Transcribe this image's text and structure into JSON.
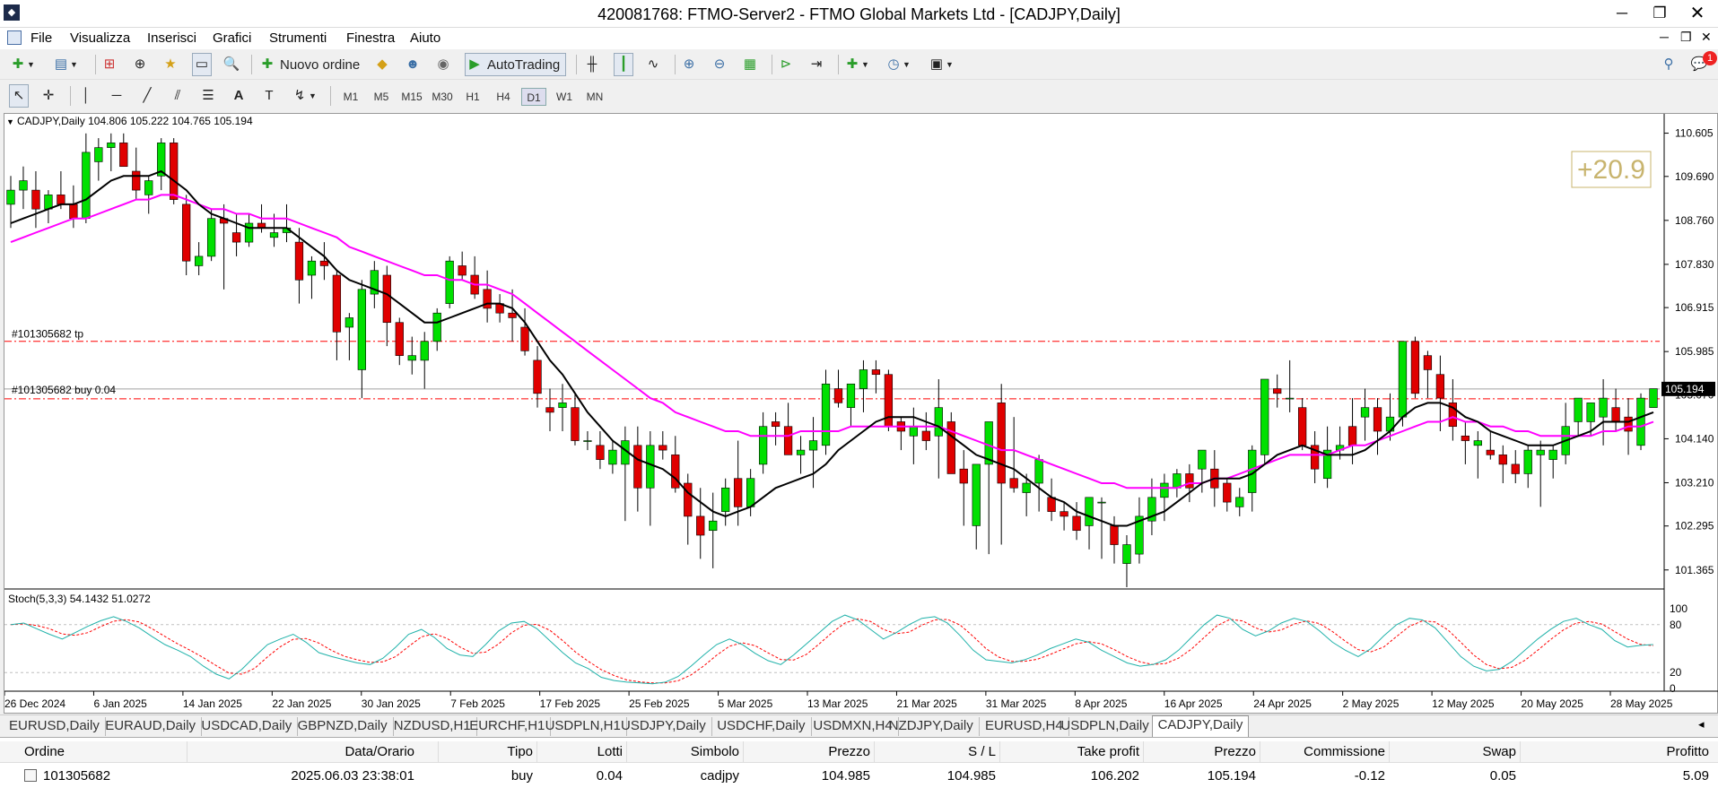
{
  "window": {
    "title": "420081768: FTMO-Server2 - FTMO Global Markets Ltd - [CADJPY,Daily]",
    "app_icon": "mt4-icon"
  },
  "menu": [
    "File",
    "Visualizza",
    "Inserisci",
    "Grafici",
    "Strumenti",
    "Finestra",
    "Aiuto"
  ],
  "toolbar": {
    "new_order": "Nuovo ordine",
    "autotrading": "AutoTrading"
  },
  "timeframes": [
    "M1",
    "M5",
    "M15",
    "M30",
    "H1",
    "H4",
    "D1",
    "W1",
    "MN"
  ],
  "active_timeframe": "D1",
  "notifications": {
    "count": "1"
  },
  "chart": {
    "header": "CADJPY,Daily  104.806 105.222 104.765 105.194",
    "profit_badge": "+20.9",
    "current_price": "105.194",
    "tp_label": "#101305682 tp",
    "buy_label": "#101305682 buy 0.04",
    "price_ticks": [
      "110.605",
      "109.690",
      "108.760",
      "107.830",
      "106.915",
      "105.985",
      "105.070",
      "104.140",
      "103.210",
      "102.295",
      "101.365"
    ],
    "date_ticks": [
      "26 Dec 2024",
      "6 Jan 2025",
      "14 Jan 2025",
      "22 Jan 2025",
      "30 Jan 2025",
      "7 Feb 2025",
      "17 Feb 2025",
      "25 Feb 2025",
      "5 Mar 2025",
      "13 Mar 2025",
      "21 Mar 2025",
      "31 Mar 2025",
      "8 Apr 2025",
      "16 Apr 2025",
      "24 Apr 2025",
      "2 May 2025",
      "12 May 2025",
      "20 May 2025",
      "28 May 2025"
    ],
    "stoch_header": "Stoch(5,3,3) 54.1432 51.0272",
    "stoch_ticks": [
      "100",
      "80",
      "20",
      "0"
    ],
    "colors": {
      "bull": "#00e000",
      "bear": "#e00000",
      "ma_fast": "#000000",
      "ma_slow": "#ff00ff",
      "stoch_main": "#20b2aa",
      "stoch_signal": "#ff0000",
      "level_line": "#ff0000"
    }
  },
  "chart_data": {
    "type": "candlestick",
    "symbol": "CADJPY",
    "timeframe": "Daily",
    "ylim": [
      101.0,
      110.9
    ],
    "tp_level": 106.202,
    "entry_level": 104.985,
    "candles": [
      [
        109.1,
        109.7,
        108.6,
        109.4
      ],
      [
        109.4,
        109.9,
        109.0,
        109.6
      ],
      [
        109.4,
        109.8,
        108.6,
        109.0
      ],
      [
        109.0,
        109.4,
        108.7,
        109.3
      ],
      [
        109.3,
        109.8,
        109.0,
        109.1
      ],
      [
        109.1,
        109.5,
        108.6,
        108.8
      ],
      [
        108.8,
        110.6,
        108.7,
        110.2
      ],
      [
        110.0,
        110.5,
        109.6,
        110.3
      ],
      [
        110.3,
        110.6,
        109.8,
        110.4
      ],
      [
        110.4,
        110.6,
        109.9,
        109.9
      ],
      [
        109.8,
        110.3,
        109.2,
        109.4
      ],
      [
        109.3,
        109.7,
        108.9,
        109.6
      ],
      [
        109.7,
        110.5,
        109.4,
        110.4
      ],
      [
        110.4,
        110.5,
        109.1,
        109.2
      ],
      [
        109.1,
        109.3,
        107.6,
        107.9
      ],
      [
        107.8,
        108.3,
        107.6,
        108.0
      ],
      [
        108.0,
        109.0,
        107.9,
        108.8
      ],
      [
        108.8,
        109.1,
        107.3,
        108.7
      ],
      [
        108.5,
        108.9,
        108.0,
        108.3
      ],
      [
        108.3,
        108.9,
        108.2,
        108.7
      ],
      [
        108.7,
        109.1,
        108.5,
        108.6
      ],
      [
        108.4,
        108.9,
        108.2,
        108.5
      ],
      [
        108.5,
        109.1,
        108.3,
        108.6
      ],
      [
        108.3,
        108.6,
        107.0,
        107.5
      ],
      [
        107.6,
        108.0,
        107.1,
        107.9
      ],
      [
        107.9,
        108.3,
        107.5,
        107.8
      ],
      [
        107.6,
        107.7,
        105.8,
        106.4
      ],
      [
        106.5,
        106.8,
        105.8,
        106.7
      ],
      [
        105.6,
        107.5,
        105.0,
        107.3
      ],
      [
        107.2,
        107.9,
        106.9,
        107.7
      ],
      [
        107.6,
        107.8,
        106.1,
        106.6
      ],
      [
        106.6,
        106.7,
        105.7,
        105.9
      ],
      [
        105.8,
        106.3,
        105.5,
        105.9
      ],
      [
        105.8,
        106.4,
        105.2,
        106.2
      ],
      [
        106.2,
        106.9,
        106.0,
        106.8
      ],
      [
        107.0,
        108.0,
        106.9,
        107.9
      ],
      [
        107.8,
        108.1,
        107.5,
        107.6
      ],
      [
        107.6,
        108.0,
        107.1,
        107.2
      ],
      [
        107.3,
        107.7,
        106.6,
        106.9
      ],
      [
        107.0,
        107.2,
        106.6,
        106.8
      ],
      [
        106.8,
        107.3,
        106.2,
        106.7
      ],
      [
        106.5,
        106.9,
        105.9,
        106.0
      ],
      [
        105.8,
        106.1,
        104.8,
        105.1
      ],
      [
        104.8,
        105.2,
        104.3,
        104.7
      ],
      [
        104.8,
        105.3,
        104.3,
        104.9
      ],
      [
        104.8,
        105.1,
        104.0,
        104.1
      ],
      [
        104.1,
        104.3,
        103.9,
        104.1
      ],
      [
        104.0,
        104.3,
        103.5,
        103.7
      ],
      [
        103.6,
        104.1,
        103.4,
        103.9
      ],
      [
        103.6,
        104.4,
        102.4,
        104.1
      ],
      [
        104.0,
        104.4,
        102.6,
        103.1
      ],
      [
        103.1,
        104.3,
        102.3,
        104.0
      ],
      [
        104.0,
        104.3,
        103.7,
        103.9
      ],
      [
        103.8,
        104.2,
        103.0,
        103.1
      ],
      [
        103.2,
        103.4,
        101.9,
        102.5
      ],
      [
        102.5,
        103.1,
        101.6,
        102.1
      ],
      [
        102.2,
        103.0,
        101.4,
        102.4
      ],
      [
        102.6,
        103.3,
        102.3,
        103.1
      ],
      [
        103.3,
        104.1,
        102.3,
        102.7
      ],
      [
        102.7,
        103.5,
        102.5,
        103.3
      ],
      [
        103.6,
        104.7,
        103.4,
        104.4
      ],
      [
        104.5,
        104.7,
        104.0,
        104.4
      ],
      [
        104.4,
        104.9,
        103.8,
        103.8
      ],
      [
        103.8,
        104.2,
        103.4,
        103.9
      ],
      [
        103.9,
        104.6,
        103.1,
        104.1
      ],
      [
        104.0,
        105.6,
        103.8,
        105.3
      ],
      [
        105.2,
        105.6,
        104.8,
        104.9
      ],
      [
        104.8,
        105.3,
        104.4,
        105.3
      ],
      [
        105.2,
        105.8,
        104.7,
        105.6
      ],
      [
        105.6,
        105.8,
        105.1,
        105.5
      ],
      [
        105.5,
        105.6,
        104.3,
        104.4
      ],
      [
        104.5,
        104.6,
        103.9,
        104.3
      ],
      [
        104.2,
        104.8,
        103.6,
        104.4
      ],
      [
        104.3,
        104.7,
        103.9,
        104.1
      ],
      [
        104.2,
        105.4,
        103.3,
        104.8
      ],
      [
        104.5,
        104.7,
        103.5,
        103.4
      ],
      [
        103.5,
        103.9,
        102.3,
        103.2
      ],
      [
        102.3,
        103.5,
        101.8,
        103.6
      ],
      [
        103.6,
        104.4,
        101.7,
        104.5
      ],
      [
        104.9,
        105.3,
        101.9,
        103.2
      ],
      [
        103.3,
        104.6,
        103.0,
        103.1
      ],
      [
        103.0,
        103.4,
        102.5,
        103.2
      ],
      [
        103.2,
        103.8,
        102.6,
        103.7
      ],
      [
        102.9,
        103.3,
        102.4,
        102.6
      ],
      [
        102.6,
        102.8,
        102.2,
        102.5
      ],
      [
        102.5,
        102.8,
        102.0,
        102.2
      ],
      [
        102.3,
        102.9,
        101.8,
        102.9
      ],
      [
        102.8,
        102.9,
        101.6,
        102.8
      ],
      [
        102.3,
        102.5,
        101.5,
        101.9
      ],
      [
        101.5,
        102.1,
        101.0,
        101.9
      ],
      [
        101.7,
        102.9,
        101.5,
        102.5
      ],
      [
        102.4,
        103.3,
        102.1,
        102.9
      ],
      [
        102.9,
        103.4,
        102.4,
        103.2
      ],
      [
        103.1,
        103.5,
        102.9,
        103.4
      ],
      [
        103.4,
        103.6,
        102.8,
        103.1
      ],
      [
        103.5,
        103.9,
        103.0,
        103.9
      ],
      [
        103.5,
        103.9,
        102.7,
        103.1
      ],
      [
        103.2,
        103.3,
        102.6,
        102.8
      ],
      [
        102.7,
        103.1,
        102.5,
        102.9
      ],
      [
        103.0,
        104.0,
        102.6,
        103.9
      ],
      [
        103.8,
        105.0,
        103.6,
        105.4
      ],
      [
        105.2,
        105.5,
        104.8,
        105.1
      ],
      [
        105.0,
        105.8,
        104.7,
        105.0
      ],
      [
        104.8,
        105.0,
        103.9,
        104.0
      ],
      [
        104.0,
        104.3,
        103.2,
        103.5
      ],
      [
        103.3,
        104.4,
        103.1,
        103.9
      ],
      [
        103.9,
        104.4,
        103.7,
        104.0
      ],
      [
        104.4,
        105.0,
        103.6,
        104.0
      ],
      [
        104.6,
        105.2,
        104.1,
        104.8
      ],
      [
        104.8,
        105.0,
        103.8,
        104.3
      ],
      [
        104.3,
        105.1,
        104.1,
        104.6
      ],
      [
        104.6,
        106.2,
        104.4,
        106.2
      ],
      [
        106.2,
        106.3,
        105.0,
        105.1
      ],
      [
        105.9,
        106.0,
        105.0,
        105.6
      ],
      [
        105.5,
        105.9,
        104.3,
        105.0
      ],
      [
        104.9,
        105.4,
        104.1,
        104.4
      ],
      [
        104.2,
        104.5,
        103.6,
        104.1
      ],
      [
        104.0,
        104.3,
        103.3,
        104.1
      ],
      [
        103.9,
        104.3,
        103.7,
        103.8
      ],
      [
        103.8,
        104.0,
        103.2,
        103.6
      ],
      [
        103.6,
        103.9,
        103.2,
        103.4
      ],
      [
        103.4,
        104.0,
        103.1,
        103.9
      ],
      [
        103.8,
        104.1,
        102.7,
        103.9
      ],
      [
        103.7,
        104.0,
        103.3,
        103.9
      ],
      [
        103.8,
        104.9,
        103.6,
        104.4
      ],
      [
        104.5,
        105.0,
        104.2,
        105.0
      ],
      [
        104.5,
        104.9,
        104.2,
        104.9
      ],
      [
        104.6,
        105.4,
        104.0,
        105.0
      ],
      [
        104.8,
        105.2,
        104.3,
        104.5
      ],
      [
        104.6,
        105.0,
        103.8,
        104.3
      ],
      [
        104.0,
        105.1,
        103.9,
        105.0
      ],
      [
        104.8,
        105.2,
        104.8,
        105.2
      ]
    ],
    "ma_fast": [
      108.7,
      108.8,
      108.9,
      109.0,
      109.1,
      109.1,
      109.2,
      109.4,
      109.6,
      109.7,
      109.7,
      109.7,
      109.8,
      109.6,
      109.4,
      109.1,
      108.9,
      108.8,
      108.7,
      108.6,
      108.6,
      108.6,
      108.6,
      108.4,
      108.2,
      108.0,
      107.7,
      107.5,
      107.4,
      107.3,
      107.2,
      107.0,
      106.8,
      106.6,
      106.6,
      106.7,
      106.8,
      106.9,
      107.0,
      107.0,
      106.9,
      106.6,
      106.2,
      105.8,
      105.5,
      105.1,
      104.7,
      104.4,
      104.1,
      103.9,
      103.7,
      103.6,
      103.5,
      103.3,
      103.0,
      102.8,
      102.6,
      102.5,
      102.6,
      102.7,
      102.9,
      103.1,
      103.2,
      103.3,
      103.4,
      103.6,
      103.9,
      104.1,
      104.3,
      104.5,
      104.6,
      104.6,
      104.6,
      104.5,
      104.4,
      104.2,
      104.0,
      103.8,
      103.7,
      103.6,
      103.5,
      103.3,
      103.1,
      102.9,
      102.8,
      102.6,
      102.5,
      102.4,
      102.3,
      102.3,
      102.4,
      102.5,
      102.6,
      102.8,
      103.0,
      103.2,
      103.3,
      103.3,
      103.3,
      103.4,
      103.6,
      103.8,
      103.9,
      104.0,
      103.9,
      103.8,
      103.8,
      103.8,
      103.9,
      104.1,
      104.3,
      104.6,
      104.8,
      104.9,
      104.9,
      104.8,
      104.6,
      104.5,
      104.3,
      104.2,
      104.1,
      104.0,
      104.0,
      104.0,
      104.1,
      104.2,
      104.3,
      104.5,
      104.5,
      104.5,
      104.6,
      104.7
    ],
    "ma_slow": [
      108.3,
      108.4,
      108.5,
      108.6,
      108.7,
      108.8,
      108.8,
      108.9,
      109.0,
      109.1,
      109.2,
      109.2,
      109.3,
      109.3,
      109.2,
      109.1,
      109.0,
      109.0,
      108.9,
      108.9,
      108.8,
      108.8,
      108.8,
      108.7,
      108.6,
      108.5,
      108.4,
      108.2,
      108.1,
      108.0,
      107.9,
      107.8,
      107.7,
      107.6,
      107.6,
      107.5,
      107.5,
      107.4,
      107.4,
      107.3,
      107.2,
      107.0,
      106.8,
      106.6,
      106.4,
      106.2,
      106.0,
      105.8,
      105.6,
      105.4,
      105.2,
      105.0,
      104.9,
      104.7,
      104.6,
      104.5,
      104.4,
      104.3,
      104.3,
      104.2,
      104.2,
      104.2,
      104.2,
      104.3,
      104.3,
      104.3,
      104.3,
      104.4,
      104.4,
      104.4,
      104.4,
      104.4,
      104.4,
      104.4,
      104.4,
      104.3,
      104.2,
      104.1,
      104.0,
      103.9,
      103.9,
      103.8,
      103.7,
      103.6,
      103.5,
      103.4,
      103.3,
      103.2,
      103.2,
      103.1,
      103.1,
      103.1,
      103.1,
      103.1,
      103.2,
      103.2,
      103.3,
      103.3,
      103.4,
      103.5,
      103.6,
      103.7,
      103.8,
      103.8,
      103.8,
      103.8,
      103.9,
      104.0,
      104.0,
      104.1,
      104.2,
      104.3,
      104.4,
      104.5,
      104.5,
      104.6,
      104.5,
      104.5,
      104.4,
      104.4,
      104.3,
      104.3,
      104.2,
      104.2,
      104.2,
      104.2,
      104.2,
      104.3,
      104.3,
      104.4,
      104.4,
      104.5
    ],
    "stoch_main": [
      80,
      82,
      75,
      68,
      62,
      70,
      78,
      85,
      90,
      84,
      76,
      65,
      55,
      48,
      40,
      28,
      18,
      12,
      24,
      40,
      55,
      62,
      68,
      58,
      45,
      40,
      36,
      32,
      30,
      38,
      52,
      68,
      74,
      64,
      50,
      42,
      40,
      55,
      72,
      82,
      84,
      75,
      60,
      45,
      32,
      25,
      14,
      10,
      8,
      7,
      6,
      8,
      15,
      28,
      42,
      55,
      62,
      55,
      44,
      35,
      30,
      42,
      56,
      70,
      84,
      92,
      86,
      74,
      62,
      70,
      80,
      88,
      90,
      82,
      66,
      48,
      36,
      34,
      32,
      36,
      42,
      50,
      56,
      62,
      58,
      48,
      40,
      32,
      28,
      30,
      36,
      48,
      64,
      80,
      92,
      88,
      74,
      66,
      72,
      82,
      88,
      84,
      72,
      58,
      48,
      40,
      50,
      66,
      80,
      88,
      86,
      76,
      58,
      40,
      28,
      22,
      24,
      34,
      48,
      62,
      74,
      84,
      88,
      80,
      74,
      60,
      52,
      54,
      55
    ]
  },
  "tabs": [
    "EURUSD,Daily",
    "EURAUD,Daily",
    "USDCAD,Daily",
    "GBPNZD,Daily",
    "NZDUSD,H1",
    "EURCHF,H1",
    "USDPLN,H1",
    "USDJPY,Daily",
    "USDCHF,Daily",
    "USDMXN,H4",
    "NZDJPY,Daily",
    "EURUSD,H4",
    "USDPLN,Daily",
    "CADJPY,Daily"
  ],
  "active_tab": "CADJPY,Daily",
  "terminal": {
    "columns": [
      "Ordine",
      "Data/Orario",
      "Tipo",
      "Lotti",
      "Simbolo",
      "Prezzo",
      "S / L",
      "Take profit",
      "Prezzo",
      "Commissione",
      "Swap",
      "Profitto"
    ],
    "rows": [
      [
        "101305682",
        "2025.06.03 23:38:01",
        "buy",
        "0.04",
        "cadjpy",
        "104.985",
        "104.985",
        "106.202",
        "105.194",
        "-0.12",
        "0.05",
        "5.09"
      ]
    ]
  }
}
